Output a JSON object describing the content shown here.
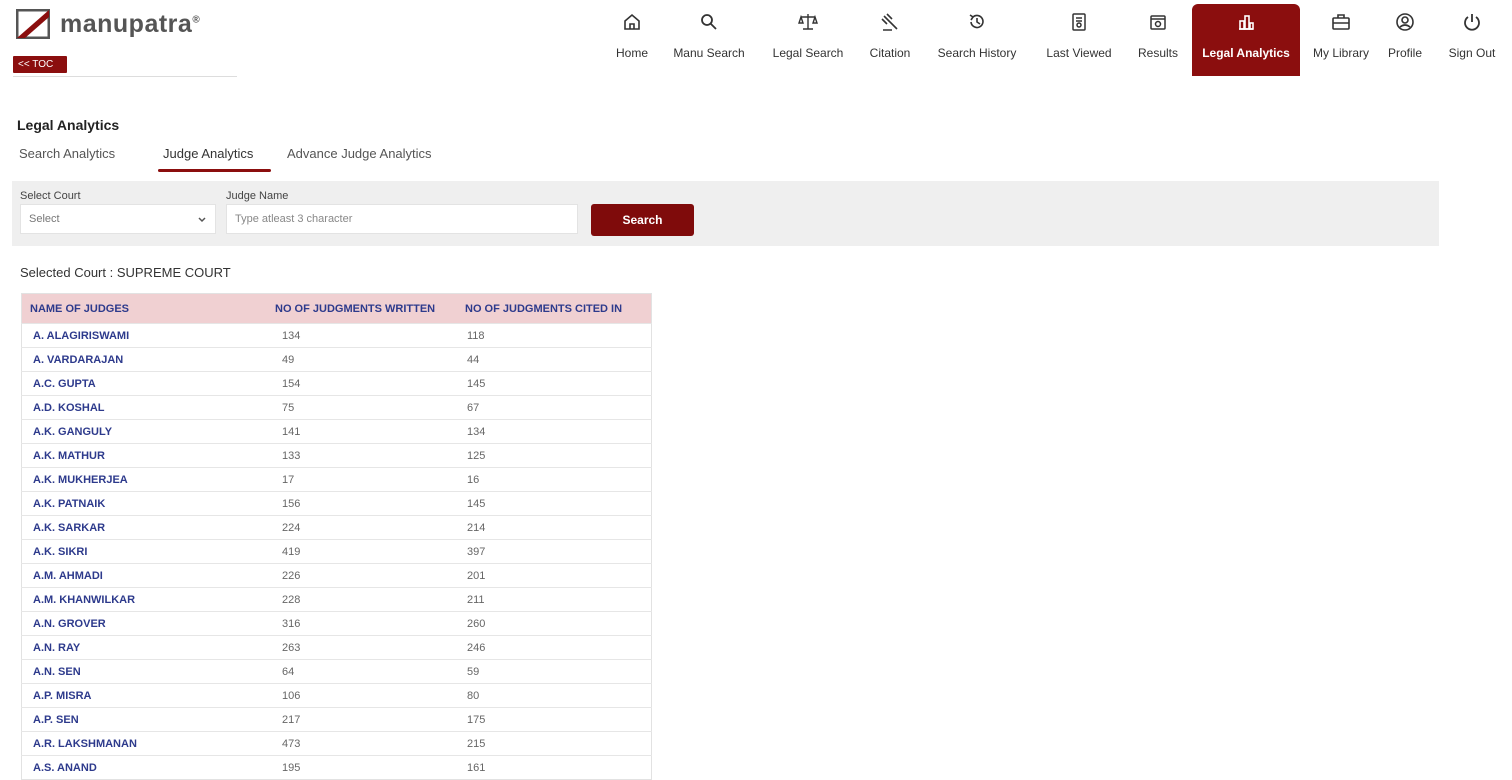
{
  "brand": {
    "name": "manupatra",
    "reg": "®",
    "toc_label": "<< TOC"
  },
  "nav": [
    {
      "label": "Home",
      "icon": "home-icon"
    },
    {
      "label": "Manu Search",
      "icon": "search-icon"
    },
    {
      "label": "Legal Search",
      "icon": "scales-icon"
    },
    {
      "label": "Citation",
      "icon": "gavel-icon"
    },
    {
      "label": "Search History",
      "icon": "history-icon"
    },
    {
      "label": "Last Viewed",
      "icon": "document-icon"
    },
    {
      "label": "Results",
      "icon": "results-icon"
    },
    {
      "label": "Legal Analytics",
      "icon": "analytics-icon",
      "active": true
    },
    {
      "label": "My Library",
      "icon": "briefcase-icon"
    },
    {
      "label": "Profile",
      "icon": "user-icon"
    },
    {
      "label": "Sign Out",
      "icon": "power-icon"
    }
  ],
  "page": {
    "title": "Legal Analytics",
    "tabs": [
      "Search Analytics",
      "Judge Analytics",
      "Advance Judge Analytics"
    ],
    "active_tab": "Judge Analytics"
  },
  "filter": {
    "court_label": "Select Court",
    "court_value": "Select",
    "judge_label": "Judge Name",
    "judge_placeholder": "Type atleast 3 character",
    "judge_value": "",
    "search_label": "Search"
  },
  "selected_court": "Selected Court : SUPREME COURT",
  "table": {
    "headers": [
      "NAME OF JUDGES",
      "NO OF JUDGMENTS WRITTEN",
      "NO OF JUDGMENTS CITED IN"
    ],
    "rows": [
      [
        "A. ALAGIRISWAMI",
        "134",
        "118"
      ],
      [
        "A. VARDARAJAN",
        "49",
        "44"
      ],
      [
        "A.C. GUPTA",
        "154",
        "145"
      ],
      [
        "A.D. KOSHAL",
        "75",
        "67"
      ],
      [
        "A.K. GANGULY",
        "141",
        "134"
      ],
      [
        "A.K. MATHUR",
        "133",
        "125"
      ],
      [
        "A.K. MUKHERJEA",
        "17",
        "16"
      ],
      [
        "A.K. PATNAIK",
        "156",
        "145"
      ],
      [
        "A.K. SARKAR",
        "224",
        "214"
      ],
      [
        "A.K. SIKRI",
        "419",
        "397"
      ],
      [
        "A.M. AHMADI",
        "226",
        "201"
      ],
      [
        "A.M. KHANWILKAR",
        "228",
        "211"
      ],
      [
        "A.N. GROVER",
        "316",
        "260"
      ],
      [
        "A.N. RAY",
        "263",
        "246"
      ],
      [
        "A.N. SEN",
        "64",
        "59"
      ],
      [
        "A.P. MISRA",
        "106",
        "80"
      ],
      [
        "A.P. SEN",
        "217",
        "175"
      ],
      [
        "A.R. LAKSHMANAN",
        "473",
        "215"
      ],
      [
        "A.S. ANAND",
        "195",
        "161"
      ]
    ]
  },
  "colors": {
    "accent": "#8b0e0e",
    "link": "#2d3a8c",
    "header_bg": "#f0d0d2",
    "filter_bg": "#efefef"
  }
}
